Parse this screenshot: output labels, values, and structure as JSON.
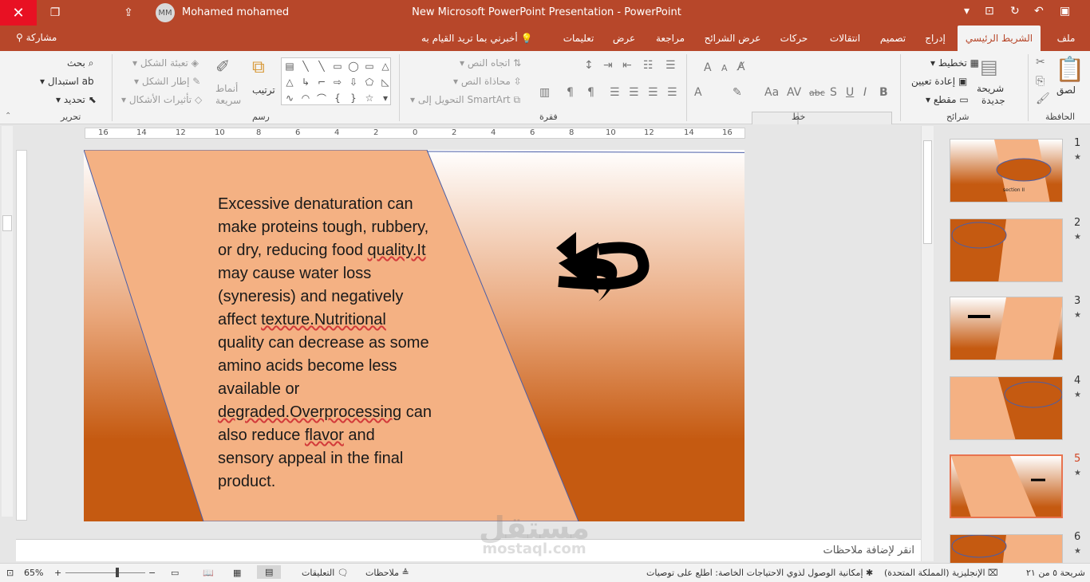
{
  "window": {
    "title": "New Microsoft PowerPoint Presentation  -  PowerPoint",
    "user_name": "Mohamed mohamed",
    "user_initials": "MM"
  },
  "tabs": [
    "ملف",
    "الشريط الرئيسي",
    "إدراج",
    "تصميم",
    "انتقالات",
    "حركات",
    "عرض الشرائح",
    "مراجعة",
    "عرض",
    "تعليمات"
  ],
  "active_tab": "الشريط الرئيسي",
  "tell_me": "أخبرني بما تريد القيام به",
  "share": "مشاركة",
  "ribbon": {
    "groups": {
      "clipboard": "الحافظة",
      "slides": "شرائح",
      "font": "خط",
      "paragraph": "فقرة",
      "drawing": "رسم",
      "editing": "تحرير"
    },
    "paste": "لصق",
    "new_slide_1": "شريحة",
    "new_slide_2": "جديدة",
    "layout": "تخطيط",
    "reset": "إعادة تعيين",
    "section": "مقطع",
    "text_direction": "اتجاه النص",
    "align_text": "محاذاة النص",
    "convert_smartart": "التحويل إلى SmartArt",
    "arrange": "ترتيب",
    "quick_styles_1": "أنماط",
    "quick_styles_2": "سريعة",
    "shape_fill": "تعبئة الشكل",
    "shape_outline": "إطار الشكل",
    "shape_effects": "تأثيرات الأشكال",
    "find": "بحث",
    "replace": "استبدال",
    "select": "تحديد"
  },
  "ruler_labels": [
    "16",
    "14",
    "12",
    "10",
    "8",
    "6",
    "4",
    "2",
    "0",
    "2",
    "4",
    "6",
    "8",
    "10",
    "12",
    "14",
    "16"
  ],
  "slide": {
    "body_plain_1": "Excessive denaturation can make proteins tough, rubbery, or dry, reducing food ",
    "body_err_1": "quality.It",
    "body_plain_2": " may cause water loss (syneresis) and negatively affect ",
    "body_err_2": "texture.Nutritional",
    "body_plain_3": " quality can decrease as some amino acids become less available or ",
    "body_err_3": "degraded.Overprocessing",
    "body_plain_4": " can also reduce ",
    "body_err_4": "flavor",
    "body_plain_5": " and sensory appeal in the final product."
  },
  "thumbnails": [
    {
      "num": "1",
      "label": "section II"
    },
    {
      "num": "2"
    },
    {
      "num": "3"
    },
    {
      "num": "4"
    },
    {
      "num": "5"
    },
    {
      "num": "6"
    }
  ],
  "selected_slide": "5",
  "notes_placeholder": "انقر لإضافة ملاحظات",
  "status": {
    "slide_count": "شريحة ٥ من ٢١",
    "language": "الإنجليزية (المملكة المتحدة)",
    "accessibility": "إمكانية الوصول لذوي الاحتياجات الخاصة: اطلع على توصيات",
    "notes": "ملاحظات",
    "comments": "التعليقات",
    "zoom": "65%"
  },
  "watermark": {
    "arabic": "مستقل",
    "latin": "mostaql.com"
  },
  "colors": {
    "accent": "#b7472a",
    "slide_orange": "#c55a11",
    "slide_peach": "#f4b183"
  }
}
